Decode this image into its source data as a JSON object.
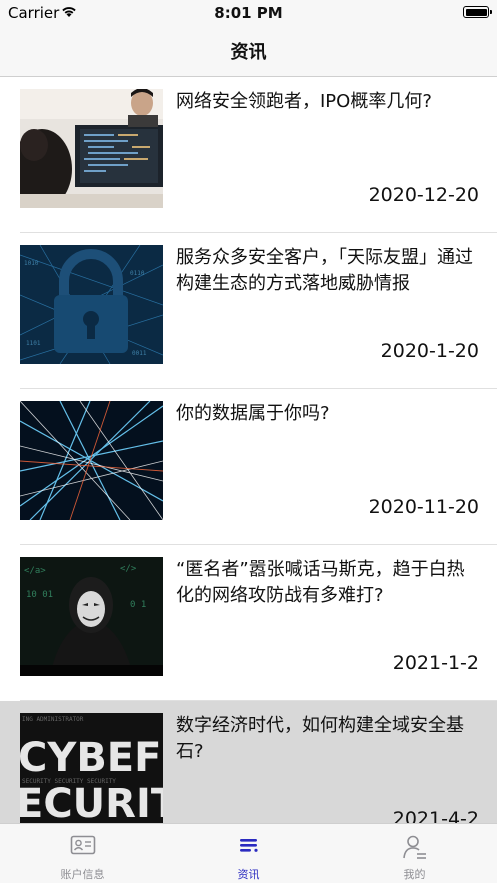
{
  "status_bar": {
    "carrier": "Carrier",
    "time": "8:01 PM"
  },
  "nav": {
    "title": "资讯"
  },
  "articles": [
    {
      "title": "网络安全领跑者，IPO概率几何?",
      "date": "2020-12-20",
      "image": "coders-at-screens"
    },
    {
      "title": "服务众多安全客户，「天际友盟」通过构建生态的方式落地威胁情报",
      "date": "2020-1-20",
      "image": "blue-padlock"
    },
    {
      "title": "你的数据属于你吗?",
      "date": "2020-11-20",
      "image": "network-light-trails"
    },
    {
      "title": "“匿名者”嚣张喊话马斯克，趋于白热化的网络攻防战有多难打?",
      "date": "2021-1-2",
      "image": "anonymous-mask-hacker"
    },
    {
      "title": "数字经济时代，如何构建全域安全基石?",
      "date": "2021-4-2",
      "image": "cyber-security-text"
    }
  ],
  "tabs": [
    {
      "label": "账户信息",
      "icon": "id-card-icon",
      "active": false
    },
    {
      "label": "资讯",
      "icon": "news-list-icon",
      "active": true
    },
    {
      "label": "我的",
      "icon": "person-icon",
      "active": false
    }
  ],
  "colors": {
    "accent": "#2b2bc0",
    "inactive": "#8e8e93",
    "bar_bg": "#f7f7f7"
  }
}
